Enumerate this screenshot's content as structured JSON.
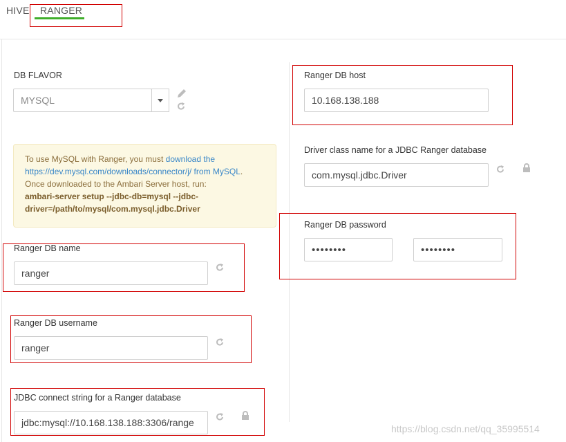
{
  "tabs": [
    {
      "label": "HIVE"
    },
    {
      "label": "RANGER",
      "active": true
    }
  ],
  "left": {
    "db_flavor": {
      "label": "DB FLAVOR",
      "value": "MYSQL"
    },
    "notice": {
      "text1": "To use MySQL with Ranger, you must ",
      "link": "download the https://dev.mysql.com/downloads/connector/j/ from MySQL",
      "text2": ".",
      "text3": "Once downloaded to the Ambari Server host, run:",
      "command": "ambari-server setup --jdbc-db=mysql --jdbc-driver=/path/to/mysql/com.mysql.jdbc.Driver"
    },
    "db_name": {
      "label": "Ranger DB name",
      "value": "ranger"
    },
    "db_username": {
      "label": "Ranger DB username",
      "value": "ranger"
    },
    "jdbc_connect": {
      "label": "JDBC connect string for a Ranger database",
      "value": "jdbc:mysql://10.168.138.188:3306/range"
    }
  },
  "right": {
    "db_host": {
      "label": "Ranger DB host",
      "value": "10.168.138.188"
    },
    "driver_class": {
      "label": "Driver class name for a JDBC Ranger database",
      "value": "com.mysql.jdbc.Driver"
    },
    "db_password": {
      "label": "Ranger DB password",
      "value": "••••••••",
      "confirm_value": "••••••••"
    }
  },
  "watermark": "https://blog.csdn.net/qq_35995514",
  "colors": {
    "accent": "#3fae2a",
    "highlight_box": "#d10000",
    "notice_bg": "#fcf8e3",
    "link": "#3a87c8"
  },
  "icons": [
    "edit-icon",
    "refresh-icon",
    "lock-icon",
    "dropdown-caret-icon"
  ]
}
